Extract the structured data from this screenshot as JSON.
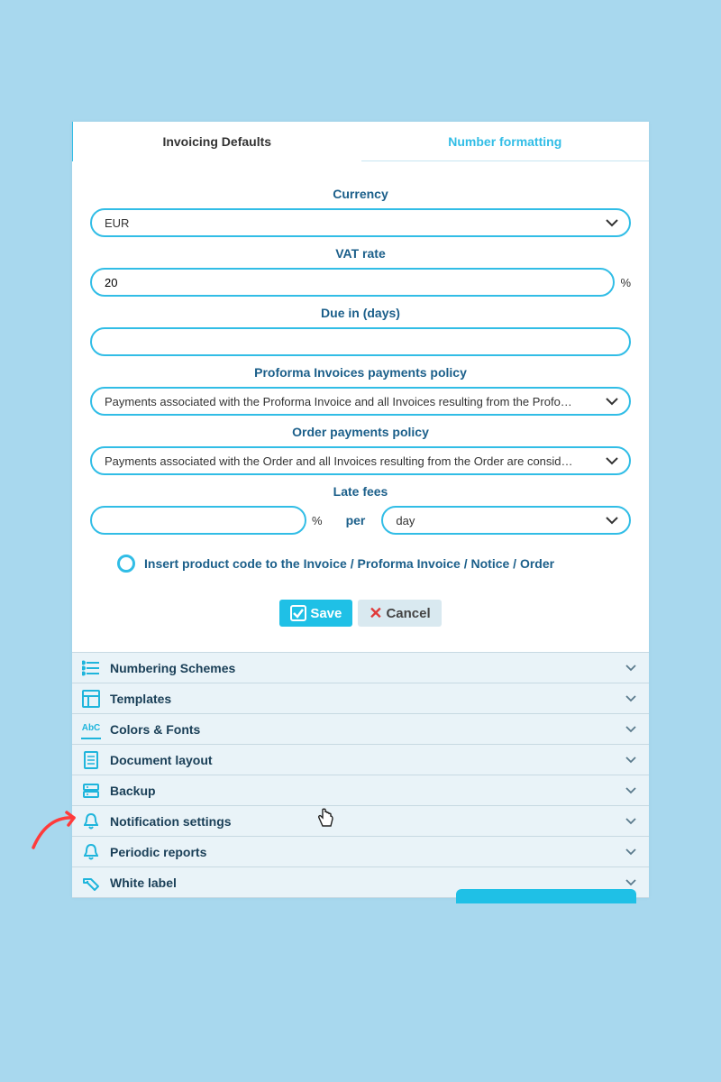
{
  "tabs": {
    "active": "Invoicing Defaults",
    "inactive": "Number formatting"
  },
  "fields": {
    "currency": {
      "label": "Currency",
      "value": "EUR"
    },
    "vat": {
      "label": "VAT rate",
      "value": "20",
      "suffix": "%"
    },
    "due": {
      "label": "Due in (days)",
      "value": ""
    },
    "proforma": {
      "label": "Proforma Invoices payments policy",
      "value": "Payments associated with the Proforma Invoice and all Invoices resulting from the Profo…"
    },
    "order": {
      "label": "Order payments policy",
      "value": "Payments associated with the Order and all Invoices resulting from the Order are consid…"
    },
    "latefees": {
      "label": "Late fees",
      "value": "",
      "suffix": "%",
      "per_label": "per",
      "per_value": "day"
    },
    "radio": {
      "label": "Insert product code to the Invoice / Proforma Invoice / Notice / Order"
    }
  },
  "buttons": {
    "save": "Save",
    "cancel": "Cancel"
  },
  "accordion": [
    {
      "icon": "list",
      "label": "Numbering Schemes"
    },
    {
      "icon": "template",
      "label": "Templates"
    },
    {
      "icon": "abc",
      "label": "Colors & Fonts"
    },
    {
      "icon": "layout",
      "label": "Document layout"
    },
    {
      "icon": "backup",
      "label": "Backup"
    },
    {
      "icon": "bell",
      "label": "Notification settings"
    },
    {
      "icon": "bell",
      "label": "Periodic reports"
    },
    {
      "icon": "tag",
      "label": "White label"
    }
  ]
}
